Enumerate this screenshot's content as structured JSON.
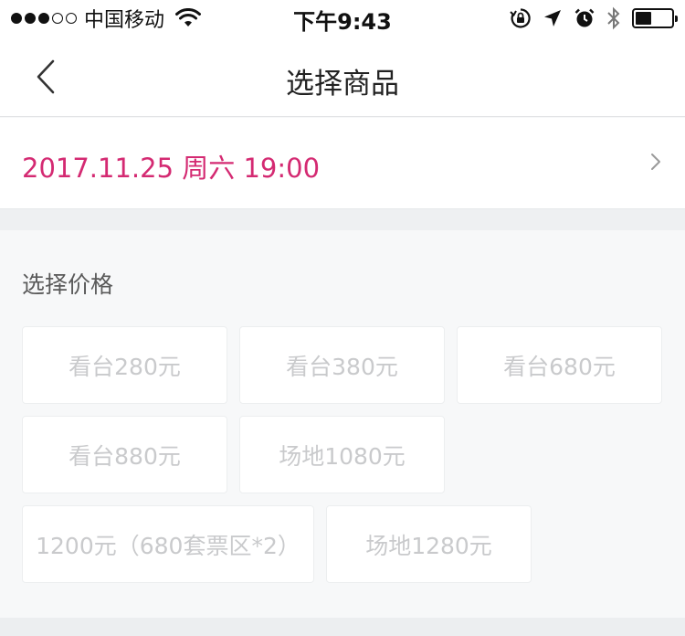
{
  "status_bar": {
    "signal": "●●●○○",
    "carrier": "中国移动",
    "time": "下午9:43",
    "icons": [
      "wifi-icon",
      "rotation-lock-icon",
      "location-arrow-icon",
      "alarm-icon",
      "bluetooth-icon",
      "battery-icon"
    ]
  },
  "nav": {
    "title": "选择商品",
    "back_icon": "chevron-left-icon"
  },
  "session": {
    "datetime": "2017.11.25 周六 19:00",
    "accent_color": "#d42a72"
  },
  "price_section": {
    "title": "选择价格",
    "options": [
      "看台280元",
      "看台380元",
      "看台680元",
      "看台880元",
      "场地1080元",
      "1200元（680套票区*2）",
      "场地1280元"
    ]
  }
}
